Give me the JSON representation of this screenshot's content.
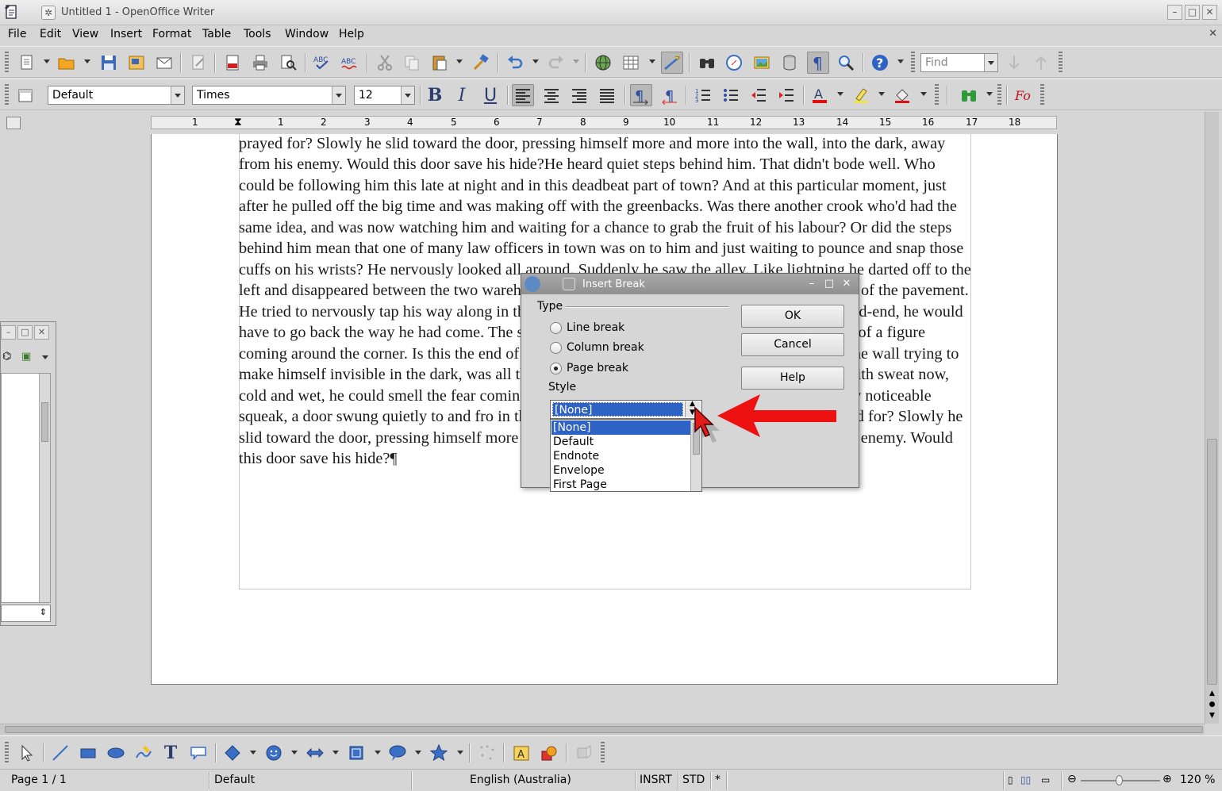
{
  "window": {
    "title": "Untitled 1 - OpenOffice Writer"
  },
  "menu": [
    "File",
    "Edit",
    "View",
    "Insert",
    "Format",
    "Table",
    "Tools",
    "Window",
    "Help"
  ],
  "formatting": {
    "paragraph_style": "Default",
    "font_name": "Times",
    "font_size": "12",
    "find_placeholder": "Find"
  },
  "ruler": {
    "numbers": [
      "1",
      "1",
      "2",
      "3",
      "4",
      "5",
      "6",
      "7",
      "8",
      "9",
      "10",
      "11",
      "12",
      "13",
      "14",
      "15",
      "16",
      "17",
      "18"
    ]
  },
  "document": {
    "text": "barely noticeable squeak, a door swung quietly to and fro in the night's breeze. Could this be the haven he'd prayed for? Slowly he slid toward the door, pressing himself more and more into the wall, into the dark, away from his enemy. Would this door save his hide?He heard quiet steps behind him. That didn't bode well. Who could be following him this late at night and in this deadbeat part of town? And at this particular moment, just after he pulled off the big time and was making off with the greenbacks. Was there another crook who'd had the same idea, and was now watching him and waiting for a chance to grab the fruit of his labour? Or did the steps behind him mean that one of many law officers in town was on to him and just waiting to pounce and snap those cuffs on his wrists? He nervously looked all around. Suddenly he saw the alley. Like lightning he darted off to the left and disappeared between the two warehouses almost falling over the bin lying in the middle of the pavement. He tried to nervously tap his way along in the inky darkness and suddenly stiffened: it was a dead-end, he would have to go back the way he had come. The steps got louder and louder, he saw the black outline of a figure coming around the corner. Is this the end of the line? he thought pressing himself back against the wall trying to make himself invisible in the dark, was all that planning and energy wasted? He was dripping with sweat now, cold and wet, he could smell the fear coming off his clothes. Suddenly next to him, with a barely noticeable squeak, a door swung quietly to and fro in the night's breeze. Could this be the haven he'd prayed for? Slowly he slid toward the door, pressing himself more and more into the wall, into the dark, away from his enemy. Would this door save his hide?¶"
  },
  "dialog": {
    "title": "Insert Break",
    "type_label": "Type",
    "options": [
      "Line break",
      "Column break",
      "Page break"
    ],
    "selected_option": "Page break",
    "style_label": "Style",
    "style_value": "[None]",
    "style_options": [
      "[None]",
      "Default",
      "Endnote",
      "Envelope",
      "First Page"
    ],
    "buttons": {
      "ok": "OK",
      "cancel": "Cancel",
      "help": "Help"
    }
  },
  "statusbar": {
    "page": "Page 1 / 1",
    "style": "Default",
    "language": "English (Australia)",
    "insert_mode": "INSRT",
    "selection_mode": "STD",
    "modified": "*",
    "zoom": "120 %"
  },
  "colors": {
    "accent_selection": "#2e62c4",
    "annotation_arrow": "#ee1111"
  }
}
